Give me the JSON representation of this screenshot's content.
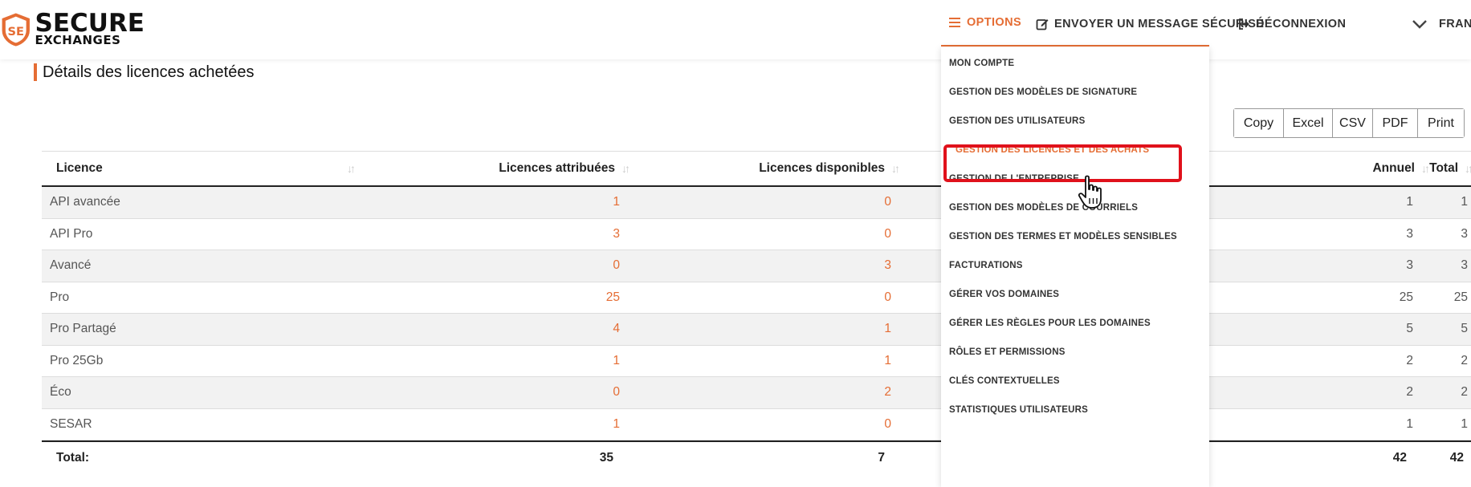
{
  "brand": {
    "line1": "SECURE",
    "line2": "EXCHANGES",
    "accent": "#e56d34"
  },
  "nav": {
    "options": "OPTIONS",
    "send_message": "ENVOYER UN MESSAGE SÉCURISÉ",
    "logout": "DÉCONNEXION",
    "language": "FRAN"
  },
  "page": {
    "title": "Détails des licences achetées"
  },
  "export": {
    "copy": "Copy",
    "excel": "Excel",
    "csv": "CSV",
    "pdf": "PDF",
    "print": "Print"
  },
  "table": {
    "headers": {
      "licence": "Licence",
      "attributed": "Licences attribuées",
      "available": "Licences disponibles",
      "annual": "Annuel",
      "total": "Total"
    },
    "rows": [
      {
        "name": "API avancée",
        "attributed": "1",
        "available": "0",
        "annual": "1",
        "total": "1"
      },
      {
        "name": "API Pro",
        "attributed": "3",
        "available": "0",
        "annual": "3",
        "total": "3"
      },
      {
        "name": "Avancé",
        "attributed": "0",
        "available": "3",
        "annual": "3",
        "total": "3"
      },
      {
        "name": "Pro",
        "attributed": "25",
        "available": "0",
        "annual": "25",
        "total": "25"
      },
      {
        "name": "Pro Partagé",
        "attributed": "4",
        "available": "1",
        "annual": "5",
        "total": "5"
      },
      {
        "name": "Pro 25Gb",
        "attributed": "1",
        "available": "1",
        "annual": "2",
        "total": "2"
      },
      {
        "name": "Éco",
        "attributed": "0",
        "available": "2",
        "annual": "2",
        "total": "2"
      },
      {
        "name": "SESAR",
        "attributed": "1",
        "available": "0",
        "annual": "1",
        "total": "1"
      }
    ],
    "footer": {
      "label": "Total:",
      "attributed": "35",
      "available": "7",
      "annual": "42",
      "total": "42"
    }
  },
  "dropdown": {
    "items": [
      "MON COMPTE",
      "GESTION DES MODÈLES DE SIGNATURE",
      "GESTION DES UTILISATEURS",
      "GESTION DES LICENCES ET DES ACHATS",
      "GESTION DE L'ENTREPRISE",
      "GESTION DES MODÈLES DE COURRIELS",
      "GESTION DES TERMES ET MODÈLES SENSIBLES",
      "FACTURATIONS",
      "GÉRER VOS DOMAINES",
      "GÉRER LES RÈGLES POUR LES DOMAINES",
      "RÔLES ET PERMISSIONS",
      "CLÉS CONTEXTUELLES",
      "STATISTIQUES UTILISATEURS"
    ],
    "active_item": "GESTION DES LICENCES ET DES ACHATS"
  }
}
